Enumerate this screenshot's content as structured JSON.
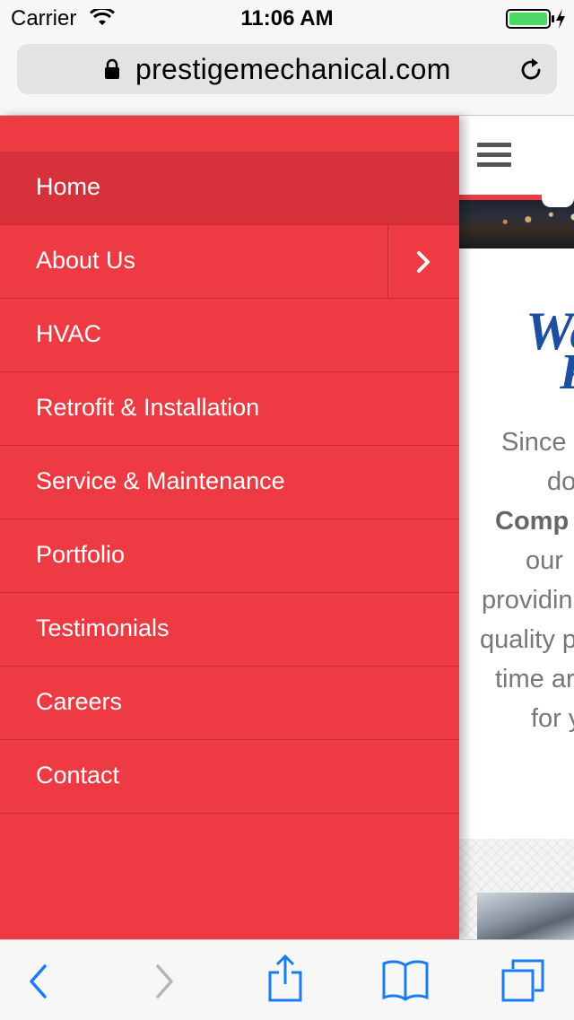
{
  "status_bar": {
    "carrier": "Carrier",
    "time": "11:06 AM",
    "battery_color": "#4cd964"
  },
  "address_bar": {
    "url": "prestigemechanical.com",
    "lock_icon": "lock-icon",
    "reload_icon": "reload-icon"
  },
  "menu": {
    "background_color": "#ee3a43",
    "items": [
      {
        "label": "Home",
        "active": true
      },
      {
        "label": "About Us",
        "has_submenu": true
      },
      {
        "label": "HVAC"
      },
      {
        "label": "Retrofit & Installation"
      },
      {
        "label": "Service & Maintenance"
      },
      {
        "label": "Portfolio"
      },
      {
        "label": "Testimonials"
      },
      {
        "label": "Careers"
      },
      {
        "label": "Contact"
      }
    ]
  },
  "page": {
    "heading_line1": "We",
    "heading_line2": "P",
    "intro_lines": [
      "Since",
      "do",
      "Comp",
      "our",
      "providin",
      "quality p",
      "time ar",
      "for y"
    ]
  },
  "toolbar": {
    "icons": [
      "back-icon",
      "forward-icon",
      "share-icon",
      "bookmarks-icon",
      "tabs-icon"
    ],
    "accent_color": "#1a7cf5"
  }
}
